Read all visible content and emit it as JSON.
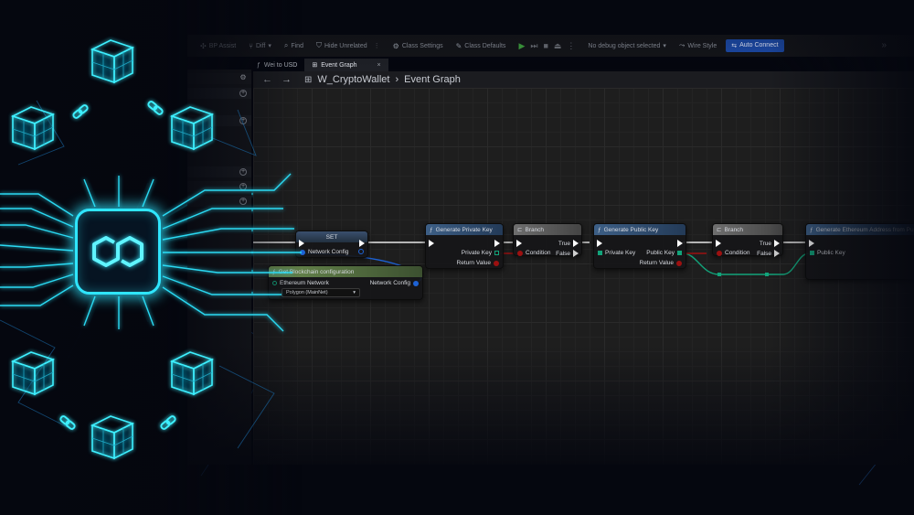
{
  "toolbar": {
    "items": [
      {
        "label": "BP Assist",
        "icon": "sparkle-icon"
      },
      {
        "label": "Diff",
        "icon": "diff-icon"
      },
      {
        "label": "Find",
        "icon": "binoculars-icon"
      },
      {
        "label": "Hide Unrelated",
        "icon": "filter-icon"
      },
      {
        "label": "Class Settings",
        "icon": "gear-icon"
      },
      {
        "label": "Class Defaults",
        "icon": "brush-icon"
      }
    ],
    "debug_selector": "No debug object selected",
    "wire_style": "Wire Style",
    "auto_connect": "Auto Connect"
  },
  "tabs": [
    {
      "label": "Wei to USD",
      "icon": "function-icon",
      "active": false
    },
    {
      "label": "Event Graph",
      "icon": "graph-icon",
      "active": true
    }
  ],
  "breadcrumb": {
    "blueprint": "W_CryptoWallet",
    "graph": "Event Graph"
  },
  "nodes": {
    "set": {
      "title": "SET",
      "pin": "Network Config"
    },
    "get_config": {
      "title": "Get Blockchain configuration",
      "in_label": "Ethereum Network",
      "out_label": "Network Config",
      "value": "Polygon (MainNet)"
    },
    "gen_private": {
      "title": "Generate Private Key",
      "out1": "Private Key",
      "out2": "Return Value"
    },
    "branch1": {
      "title": "Branch",
      "cond": "Condition",
      "t": "True",
      "f": "False"
    },
    "gen_public": {
      "title": "Generate Public Key",
      "in1": "Private Key",
      "out1": "Public Key",
      "out2": "Return Value"
    },
    "branch2": {
      "title": "Branch",
      "cond": "Condition",
      "t": "True",
      "f": "False"
    },
    "gen_eth": {
      "title": "Generate Ethereum Address from Pu",
      "in1": "Public Key"
    }
  },
  "colors": {
    "neon": "#2fe6ff",
    "node_header_function": "#3d5f86",
    "node_header_branch": "#6e6e6e",
    "node_header_pure": "#6a8a4e",
    "pin_struct": "#1e63d6",
    "pin_bool": "#9c1010",
    "pin_key": "#12a37a",
    "auto_connect_bg": "#1c4aa8"
  }
}
